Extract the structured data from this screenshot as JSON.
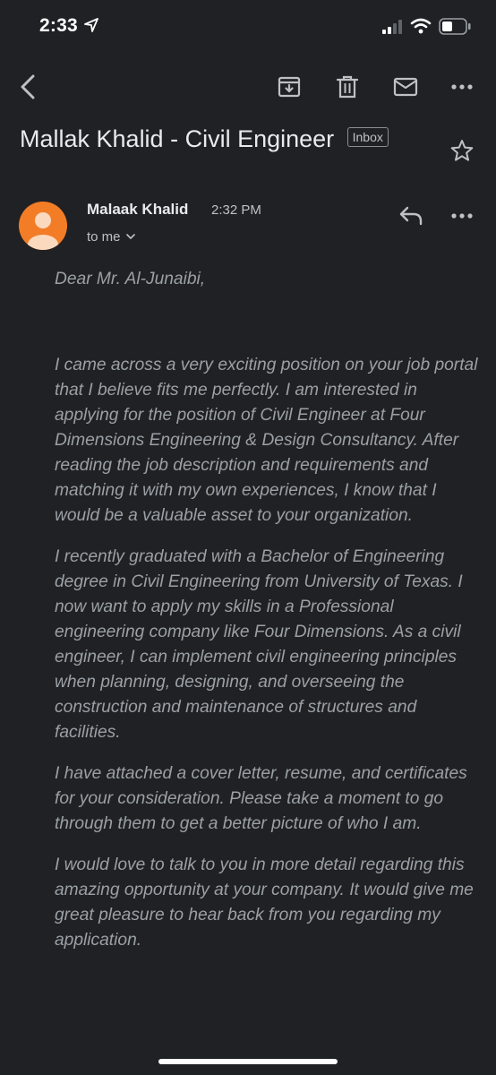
{
  "status_bar": {
    "time": "2:33"
  },
  "toolbar": {
    "icons": [
      "back-icon",
      "archive-icon",
      "trash-icon",
      "mail-icon",
      "more-icon"
    ]
  },
  "email": {
    "subject": "Mallak Khalid - Civil Engineer",
    "label": "Inbox",
    "sender": "Malaak Khalid",
    "time": "2:32 PM",
    "recipient": "to me",
    "greeting": "Dear Mr. Al-Junaibi,",
    "paragraphs": [
      "I came across a very exciting position on your job portal that I believe fits me perfectly. I am interested in applying for the position of Civil Engineer at Four Dimensions Engineering & Design Consultancy. After reading the job description and requirements and matching it with my own experiences, I know that I would be a valuable asset to your organization.",
      " I recently graduated with a Bachelor of Engineering degree in Civil Engineering from University of Texas. I now want to apply my skills in a Professional engineering company like Four Dimensions. As a civil engineer, I can implement civil engineering principles when planning, designing, and overseeing the construction and maintenance of structures and facilities.",
      "I have attached a cover letter, resume, and certificates for your consideration. Please take a moment to go through them to get a better picture of who I am.",
      "I would love to talk to you in more detail regarding this amazing opportunity at your company. It would give me great pleasure to hear back from you regarding my application."
    ]
  },
  "colors": {
    "background": "#202124",
    "avatar": "#f27d26",
    "body_text": "#9aa0a6"
  }
}
